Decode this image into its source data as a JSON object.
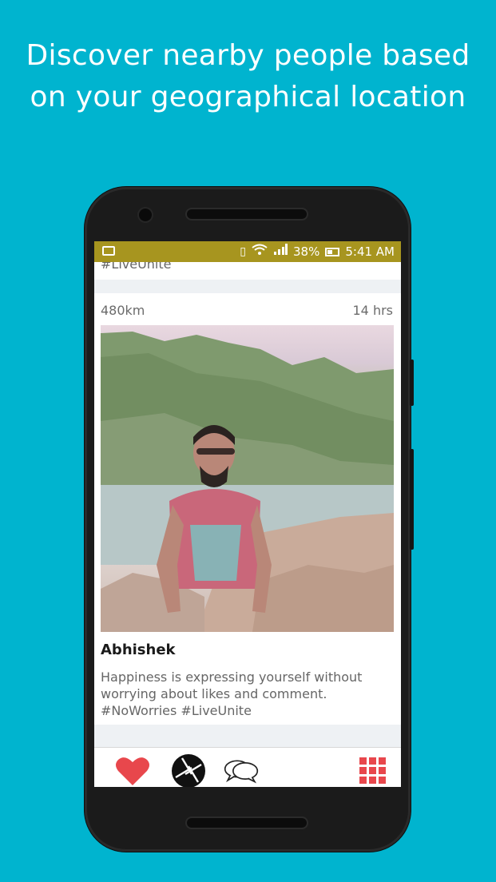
{
  "promo": {
    "headline_line1": "Discover nearby people based",
    "headline_line2": "on your geographical location"
  },
  "status_bar": {
    "battery": "38%",
    "time": "5:41 AM"
  },
  "feed": {
    "previous_post_tag": "#LiveUnite",
    "post": {
      "distance": "480km",
      "time_ago": "14 hrs",
      "author": "Abhishek",
      "caption": "Happiness is expressing yourself without worrying about likes and comment. #NoWorries #LiveUnite"
    }
  },
  "bottom_nav": {
    "items": [
      {
        "icon": "heart-icon"
      },
      {
        "icon": "camera-shutter-icon"
      },
      {
        "icon": "chat-bubbles-icon"
      },
      {
        "icon": "grid-menu-icon"
      }
    ]
  },
  "colors": {
    "background": "#00b4cf",
    "status_bar": "#a7951f",
    "accent_red": "#e8474c"
  }
}
